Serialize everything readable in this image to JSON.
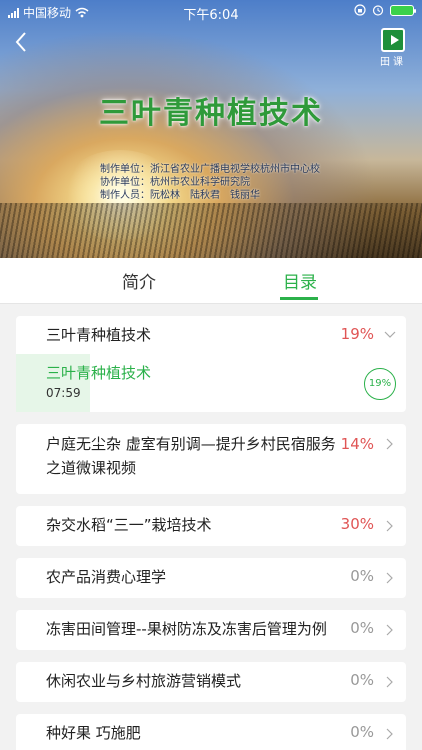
{
  "status_bar": {
    "carrier": "中国移动",
    "time": "下午6:04"
  },
  "hero": {
    "video_title": "三叶青种植技术",
    "credits": [
      "制作单位：浙江省农业广播电视学校杭州市中心校",
      "协作单位：杭州市农业科学研究院",
      "制作人员：阮松林　陆秋君　钱丽华"
    ],
    "field_class_label": "田课"
  },
  "tabs": {
    "intro": "简介",
    "catalog": "目录"
  },
  "courses": [
    {
      "title": "三叶青种植技术",
      "progress": "19%",
      "expanded": true
    },
    {
      "title_line1": "户庭无尘杂 虚室有别调—提升乡村民宿服务",
      "title_line2": "之道微课视频",
      "progress": "14%"
    },
    {
      "title": "杂交水稻“三一”栽培技术",
      "progress": "30%"
    },
    {
      "title": "农产品消费心理学",
      "progress": "0%"
    },
    {
      "title": "冻害田间管理--果树防冻及冻害后管理为例",
      "progress": "0%"
    },
    {
      "title": "休闲农业与乡村旅游营销模式",
      "progress": "0%"
    },
    {
      "title": "种好果  巧施肥",
      "progress": "0%"
    }
  ],
  "expanded_lesson": {
    "title": "三叶青种植技术",
    "duration": "07:59",
    "progress": "19%",
    "progress_fraction": 0.19
  },
  "colors": {
    "accent": "#2bb14a",
    "progress_red": "#e05555"
  }
}
